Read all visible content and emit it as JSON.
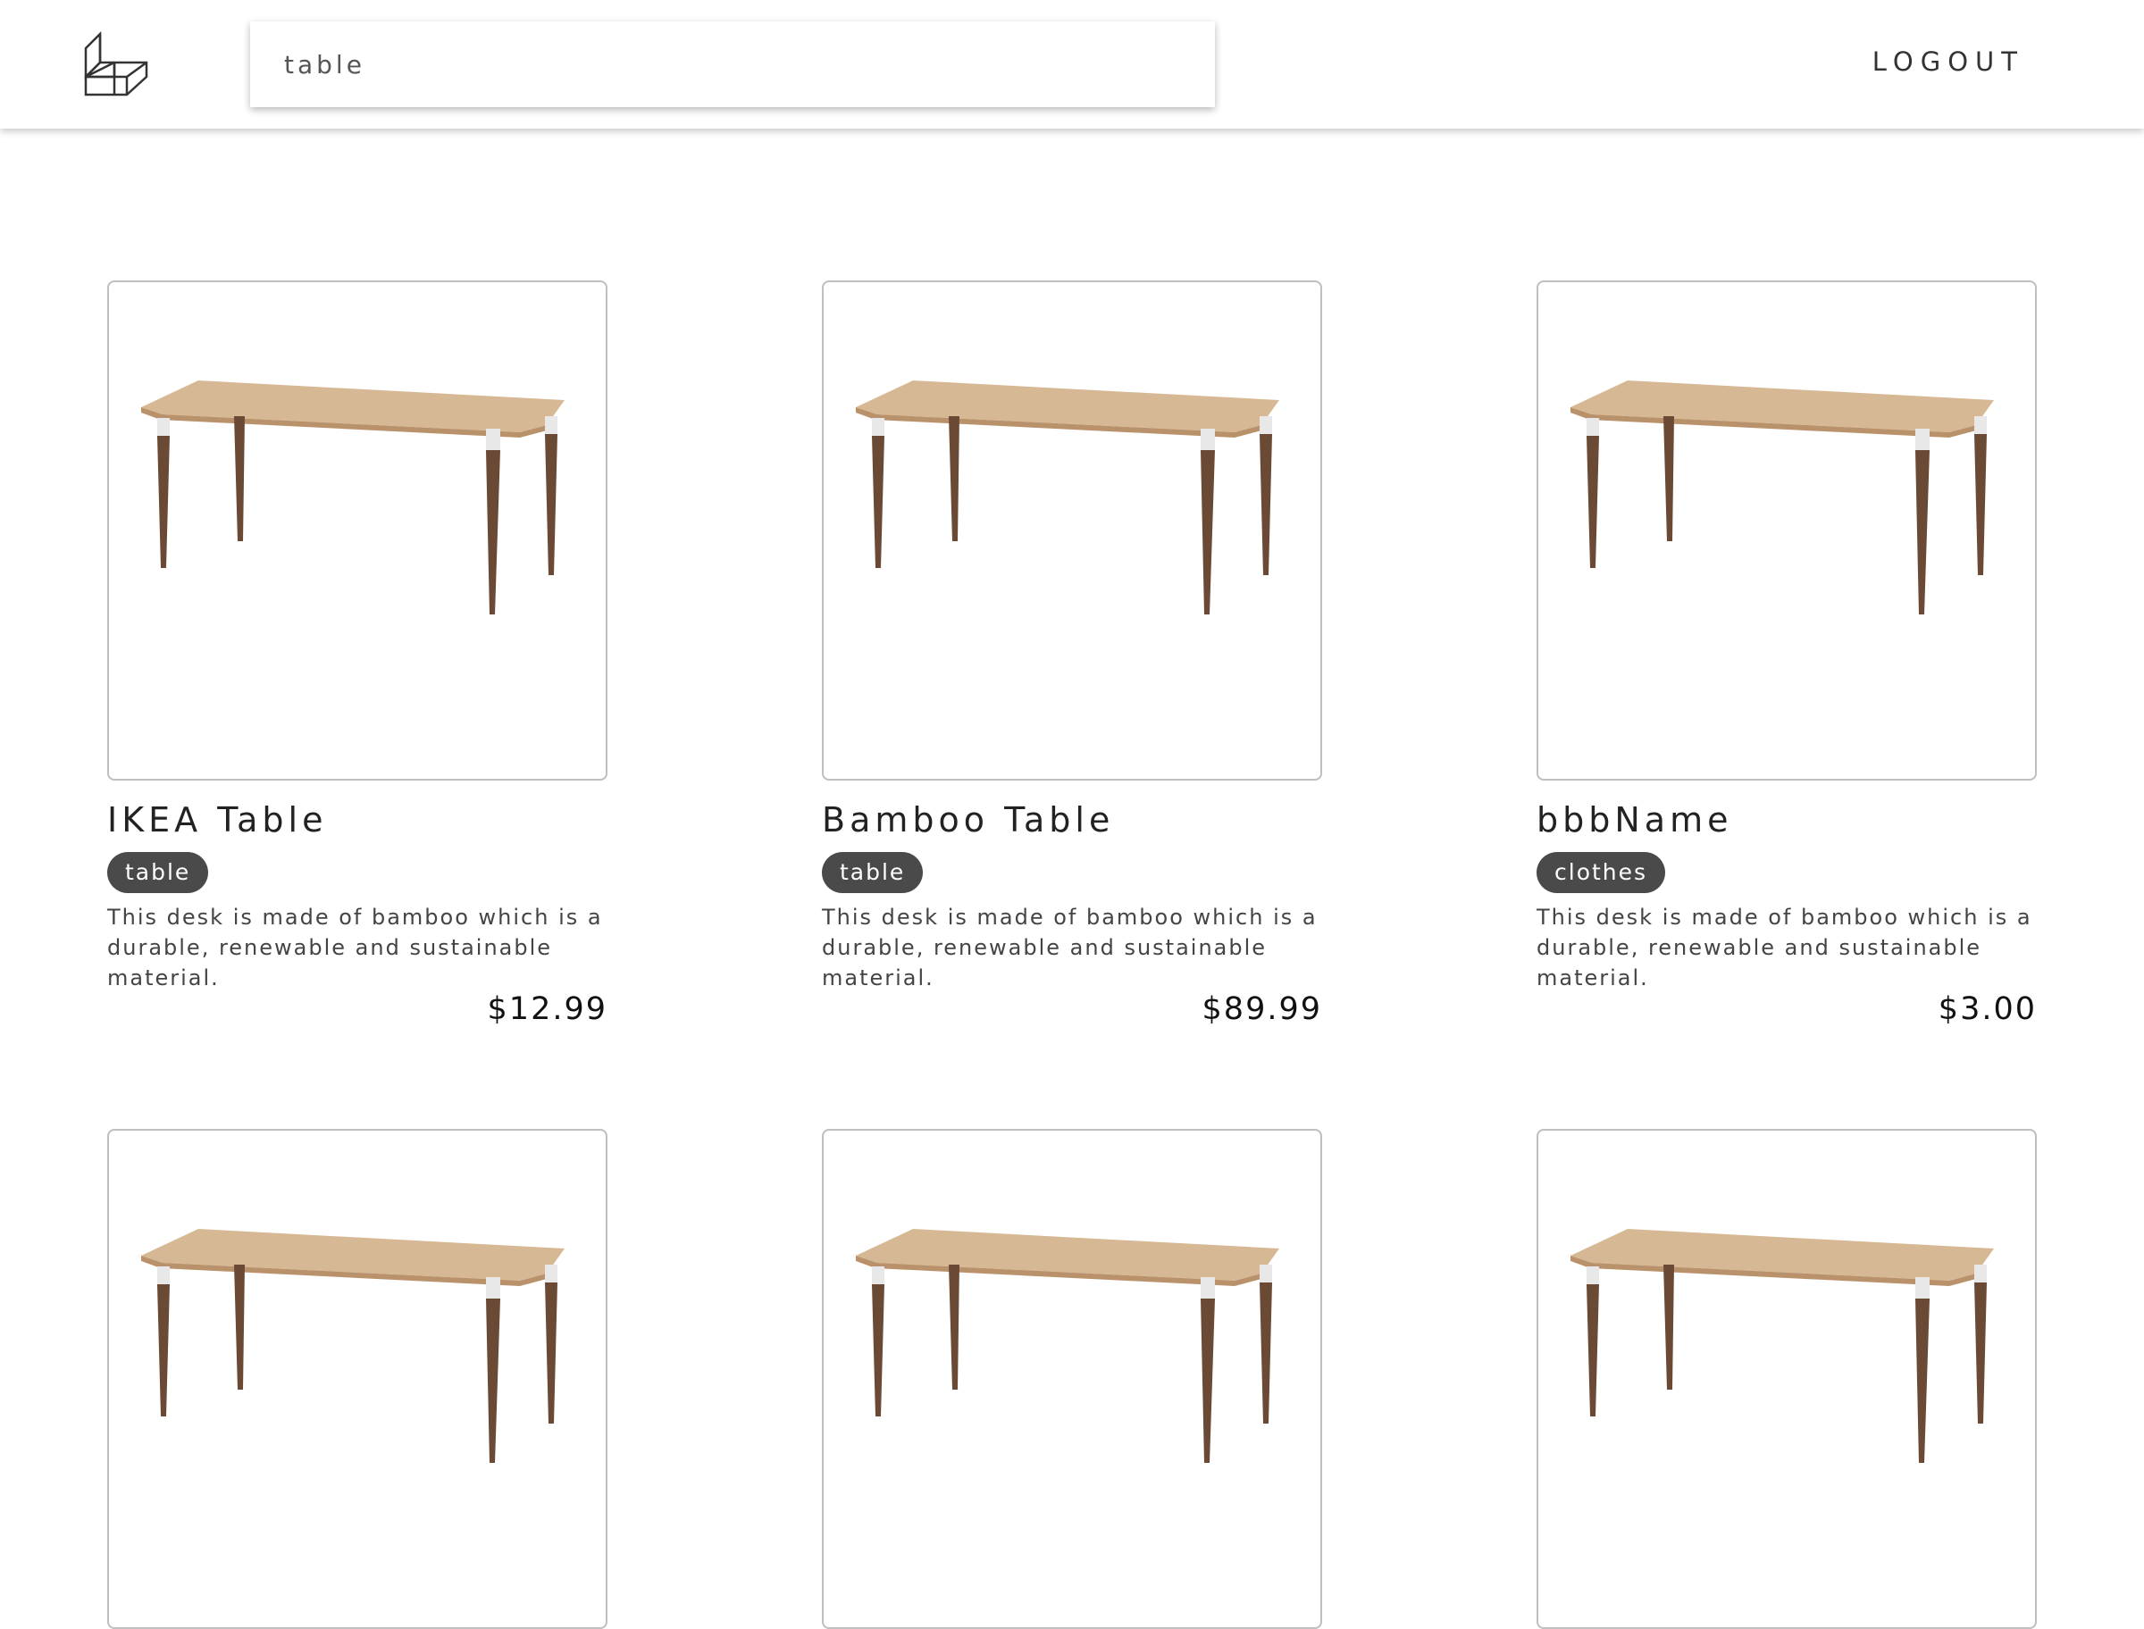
{
  "header": {
    "logo_icon": "cube-logo-icon",
    "search": {
      "value": "table",
      "placeholder": ""
    },
    "logout_label": "LOGOUT"
  },
  "products": [
    {
      "name": "IKEA Table",
      "tag": "table",
      "description": "This desk is made of bamboo which is a durable, renewable and sustainable material.",
      "price": "$12.99",
      "image_icon": "table-image"
    },
    {
      "name": "Bamboo Table",
      "tag": "table",
      "description": "This desk is made of bamboo which is a durable, renewable and sustainable material.",
      "price": "$89.99",
      "image_icon": "table-image"
    },
    {
      "name": "bbbName",
      "tag": "clothes",
      "description": "This desk is made of bamboo which is a durable, renewable and sustainable material.",
      "price": "$3.00",
      "image_icon": "table-image"
    },
    {
      "name": "",
      "tag": "",
      "description": "",
      "price": "",
      "image_icon": "table-image"
    },
    {
      "name": "",
      "tag": "",
      "description": "",
      "price": "",
      "image_icon": "table-image"
    },
    {
      "name": "",
      "tag": "",
      "description": "",
      "price": "",
      "image_icon": "table-image"
    }
  ],
  "colors": {
    "tag_background": "#4a4a4a",
    "card_border": "#bfbfbf",
    "table_top": "#d2b48f",
    "table_leg": "#6b4a35"
  }
}
